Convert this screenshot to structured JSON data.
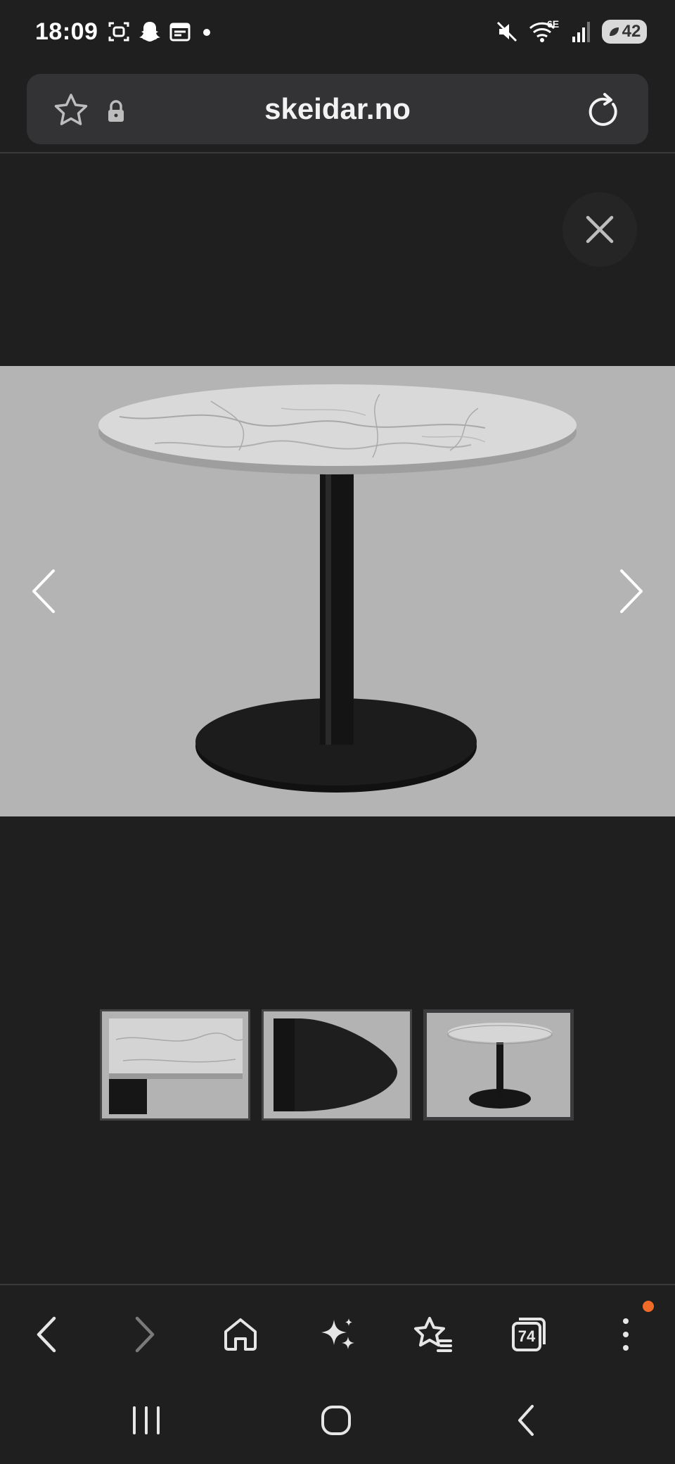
{
  "status_bar": {
    "time": "18:09",
    "battery": "42",
    "network": "6E",
    "icons_left": [
      "screenshot-icon",
      "snapchat-icon",
      "calendar-icon",
      "dot-icon"
    ],
    "icons_right": [
      "mute-icon",
      "wifi-icon",
      "signal-icon",
      "battery-icon"
    ]
  },
  "browser": {
    "url": "skeidar.no",
    "icons": [
      "star-icon",
      "lock-icon",
      "reload-icon"
    ]
  },
  "viewer": {
    "close_icon": "close-icon",
    "prev_icon": "chevron-left-icon",
    "next_icon": "chevron-right-icon",
    "thumbnails": [
      {
        "name": "thumbnail-top-detail",
        "active": false
      },
      {
        "name": "thumbnail-base-detail",
        "active": false
      },
      {
        "name": "thumbnail-full-table",
        "active": true
      }
    ],
    "colors": {
      "image_bg": "#b4b4b4",
      "viewer_bg": "#1f1f20"
    }
  },
  "toolbar": {
    "items": [
      "back-icon",
      "forward-icon",
      "home-icon",
      "sparkle-icon",
      "bookmarks-icon",
      "tabs-icon",
      "menu-icon"
    ],
    "tabs_count": "74",
    "notification_color": "#f06a28"
  },
  "system_nav": [
    "recents-icon",
    "home-circle-icon",
    "back-arrow-icon"
  ]
}
